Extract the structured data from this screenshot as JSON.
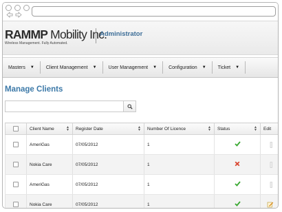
{
  "header": {
    "logo_text_bold": "RAMMP",
    "logo_text_rest": " Mobility Inc.",
    "logo_tagline": "Wireless Management. Fully Automated.",
    "role": "Administrator"
  },
  "menu": [
    {
      "label": "Masters"
    },
    {
      "label": "Client Management"
    },
    {
      "label": "User Management"
    },
    {
      "label": "Configuration"
    },
    {
      "label": "Ticket"
    }
  ],
  "page": {
    "title": "Manage Clients"
  },
  "search": {
    "value": "",
    "placeholder": ""
  },
  "table": {
    "columns": [
      "Client Name",
      "Register Date",
      "Number Of Licence",
      "Status",
      "Edit"
    ],
    "rows": [
      {
        "client": "AmeriGas",
        "date": "07/05/2012",
        "licences": "1",
        "status": "active"
      },
      {
        "client": "Nokia Care",
        "date": "07/05/2012",
        "licences": "1",
        "status": "inactive"
      },
      {
        "client": "AmeriGas",
        "date": "07/05/2012",
        "licences": "1",
        "status": "active"
      },
      {
        "client": "Nokia Care",
        "date": "07/05/2012",
        "licences": "1",
        "status": "active"
      }
    ]
  },
  "icons": {
    "status_active": "check-icon",
    "status_inactive": "cross-icon",
    "edit": "edit-icon",
    "search": "search-icon"
  },
  "colors": {
    "accent": "#3c79a8",
    "active": "#3aa832",
    "inactive": "#d9452f"
  }
}
